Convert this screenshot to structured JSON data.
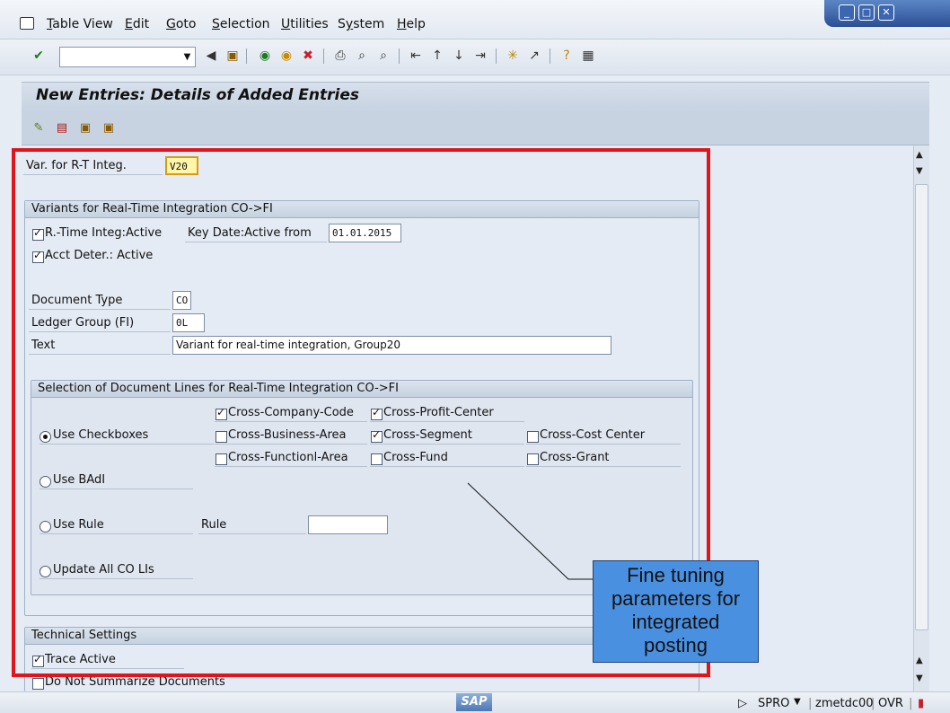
{
  "menu": {
    "items": [
      {
        "pre": "",
        "u": "T",
        "post": "able View"
      },
      {
        "pre": "",
        "u": "E",
        "post": "dit"
      },
      {
        "pre": "",
        "u": "G",
        "post": "oto"
      },
      {
        "pre": "",
        "u": "S",
        "post": "election"
      },
      {
        "pre": "",
        "u": "U",
        "post": "tilities"
      },
      {
        "pre": "S",
        "u": "y",
        "post": "stem"
      },
      {
        "pre": "",
        "u": "H",
        "post": "elp"
      }
    ]
  },
  "title": "New Entries: Details of Added Entries",
  "var_label": "Var. for R-T Integ.",
  "var_value": "V20",
  "group1": {
    "header": "Variants for Real-Time Integration CO->FI",
    "rt_active": "R.-Time Integ:Active",
    "key_date_label": "Key Date:Active from",
    "key_date_value": "01.01.2015",
    "acct_deter": "Acct Deter.: Active",
    "doc_type_label": "Document Type",
    "doc_type_value": "CO",
    "ledger_label": "Ledger Group (FI)",
    "ledger_value": "0L",
    "text_label": "Text",
    "text_value": "Variant for real-time integration, Group20"
  },
  "group2": {
    "header": "Selection of Document Lines for Real-Time Integration CO->FI",
    "use_checkboxes": "Use Checkboxes",
    "use_badi": "Use BAdI",
    "use_rule": "Use Rule",
    "rule_label": "Rule",
    "update_all": "Update All CO LIs",
    "cross_company": "Cross-Company-Code",
    "cross_profit": "Cross-Profit-Center",
    "cross_business": "Cross-Business-Area",
    "cross_segment": "Cross-Segment",
    "cross_cost": "Cross-Cost Center",
    "cross_functional": "Cross-Functionl-Area",
    "cross_fund": "Cross-Fund",
    "cross_grant": "Cross-Grant"
  },
  "group3": {
    "header": "Technical Settings",
    "trace": "Trace Active",
    "no_summarize": "Do Not Summarize Documents"
  },
  "callout": {
    "l1": "Fine tuning",
    "l2": "parameters for",
    "l3": "integrated",
    "l4": "posting"
  },
  "status": {
    "transaction": "SPRO",
    "server": "zmetdc00",
    "mode": "OVR",
    "sap_logo": "SAP"
  },
  "colors": {
    "highlight": "#e2131b",
    "callout": "#4a90e0"
  }
}
